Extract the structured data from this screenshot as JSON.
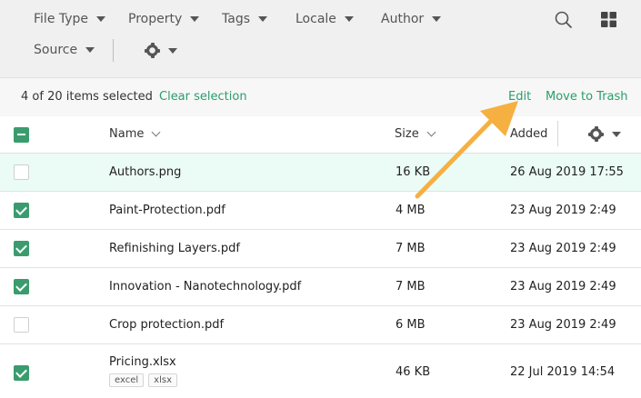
{
  "filters": {
    "file_type": "File Type",
    "property": "Property",
    "tags": "Tags",
    "locale": "Locale",
    "author": "Author",
    "source": "Source"
  },
  "toolbar_icons": [
    "search-icon",
    "grid-view-icon",
    "gear-icon"
  ],
  "selection": {
    "count_text": "4 of 20 items selected",
    "clear": "Clear selection",
    "edit": "Edit",
    "move_to_trash": "Move to Trash"
  },
  "columns": {
    "name": "Name",
    "size": "Size",
    "added": "Added"
  },
  "rows": [
    {
      "name": "Authors.png",
      "size": "16 KB",
      "added": "26 Aug 2019 17:55",
      "checked": false,
      "highlight": true
    },
    {
      "name": "Paint-Protection.pdf",
      "size": "4 MB",
      "added": "23 Aug 2019 2:49",
      "checked": true
    },
    {
      "name": "Refinishing Layers.pdf",
      "size": "7 MB",
      "added": "23 Aug 2019 2:49",
      "checked": true
    },
    {
      "name": "Innovation - Nanotechnology.pdf",
      "size": "7 MB",
      "added": "23 Aug 2019 2:49",
      "checked": true
    },
    {
      "name": "Crop protection.pdf",
      "size": "6 MB",
      "added": "23 Aug 2019 2:49",
      "checked": false
    },
    {
      "name": "Pricing.xlsx",
      "size": "46 KB",
      "added": "22 Jul 2019 14:54",
      "checked": true,
      "tags": [
        "excel",
        "xlsx"
      ]
    }
  ],
  "colors": {
    "accent_green": "#3a9c6e",
    "link_green": "#2a9d6b",
    "highlight_row": "#ebfbf6",
    "annotation_arrow": "#f5b041"
  }
}
